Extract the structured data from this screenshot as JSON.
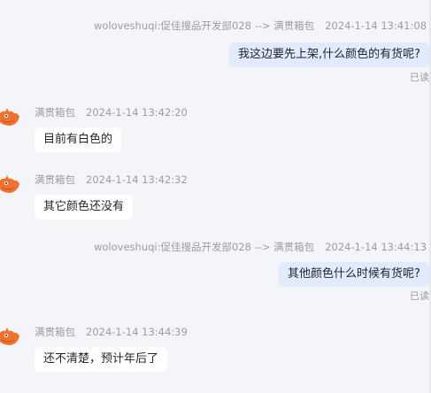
{
  "messages": [
    {
      "sender": "woloveshuqi:促佳搜品开发部028 --> 满贯箱包",
      "time": "2024-1-14 13:41:08",
      "text": "我这边要先上架,什么颜色的有货呢?",
      "status": "已读"
    },
    {
      "sender": "满贯箱包",
      "time": "2024-1-14 13:42:20",
      "text": "目前有白色的"
    },
    {
      "sender": "满贯箱包",
      "time": "2024-1-14 13:42:32",
      "text": "其它颜色还没有"
    },
    {
      "sender": "woloveshuqi:促佳搜品开发部028 --> 满贯箱包",
      "time": "2024-1-14 13:44:13",
      "text": "其他颜色什么时候有货呢?",
      "status": "已读"
    },
    {
      "sender": "满贯箱包",
      "time": "2024-1-14 13:44:39",
      "text": "还不清楚，预计年后了"
    }
  ],
  "colors": {
    "background": "#f4f5f8",
    "outgoing_bubble": "#e1ebfd",
    "incoming_bubble": "#ffffff",
    "avatar_orange": "#f0722f"
  }
}
